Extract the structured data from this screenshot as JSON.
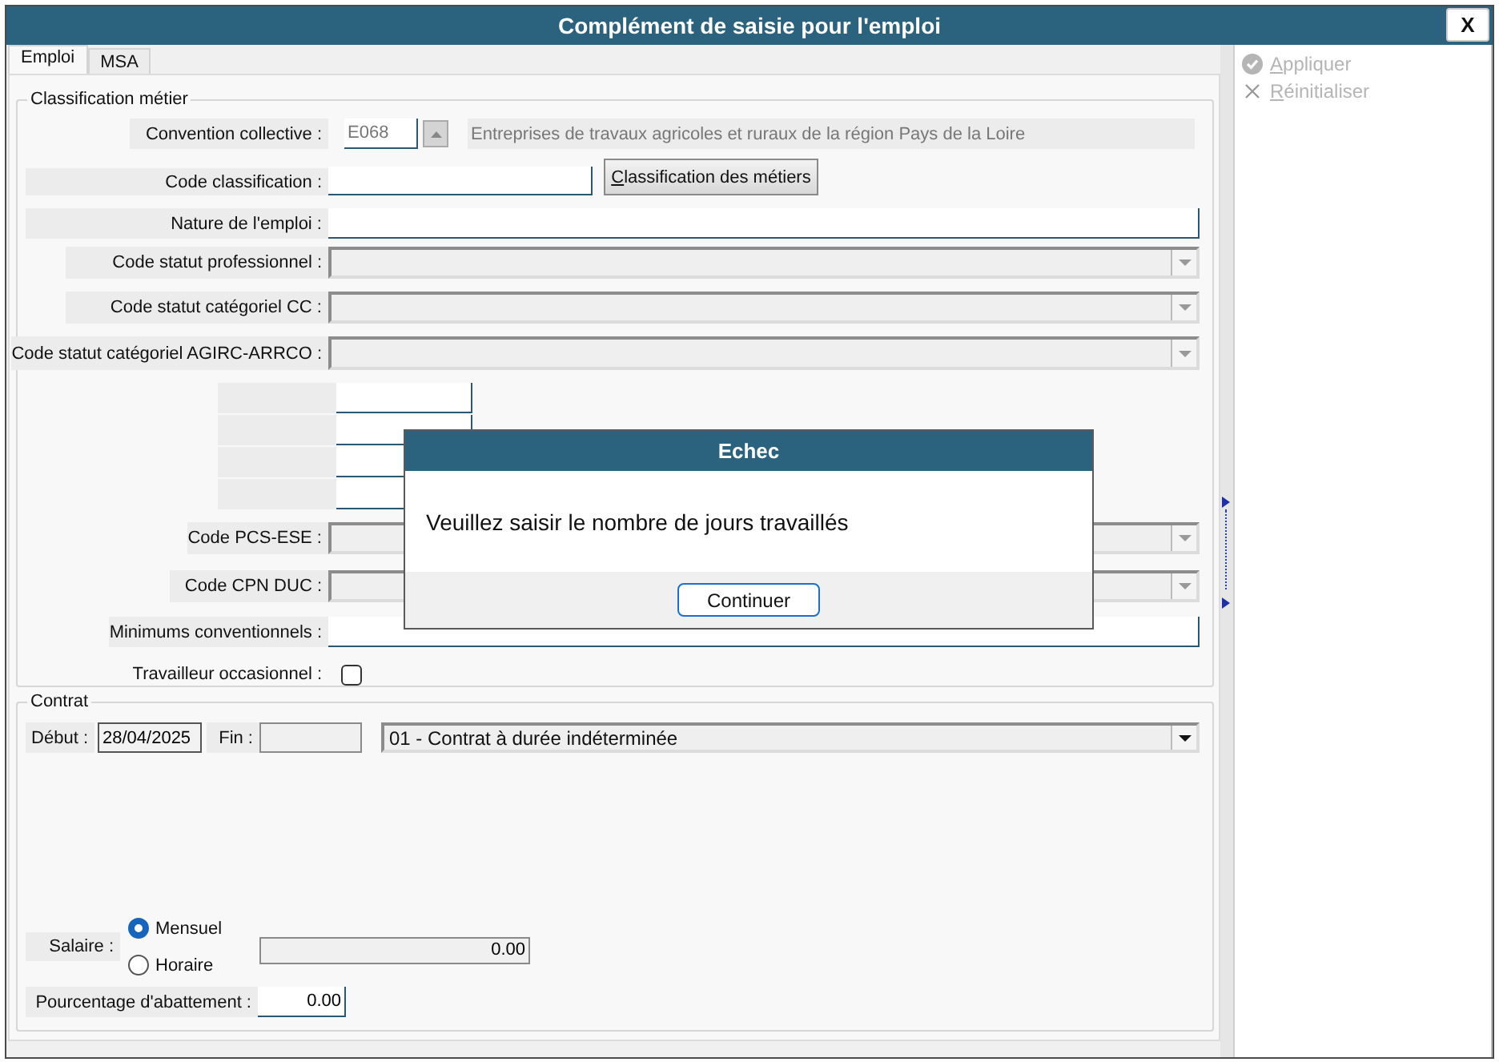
{
  "window": {
    "title": "Complément de saisie pour l'emploi",
    "close_label": "X"
  },
  "tabs": [
    {
      "label": "Emploi",
      "selected": true
    },
    {
      "label": "MSA",
      "selected": false
    }
  ],
  "classification": {
    "title": "Classification métier",
    "fields": [
      {
        "kind": "lookup",
        "label": "Convention collective :",
        "code": "E068",
        "description": "Entreprises de travaux agricoles et ruraux de la région Pays de la Loire",
        "disabled": true
      },
      {
        "kind": "input_button",
        "label": "Code classification :",
        "button": "Classification des métiers"
      },
      {
        "kind": "input",
        "label": "Nature de l'emploi :"
      },
      {
        "kind": "combo",
        "label": "Code statut professionnel :",
        "disabled": true
      },
      {
        "kind": "combo",
        "label": "Code statut catégoriel CC :",
        "disabled": true
      },
      {
        "kind": "combo",
        "label": "Code statut catégoriel AGIRC-ARRCO :",
        "disabled": true
      },
      {
        "kind": "blank_input"
      },
      {
        "kind": "blank_input"
      },
      {
        "kind": "blank_input"
      },
      {
        "kind": "blank_input"
      },
      {
        "kind": "combo",
        "label": "Code PCS-ESE :",
        "disabled": true
      },
      {
        "kind": "combo",
        "label": "Code CPN DUC :",
        "disabled": true
      },
      {
        "kind": "input",
        "label": "Minimums conventionnels :"
      },
      {
        "kind": "checkbox",
        "label": "Travailleur occasionnel :",
        "checked": false
      }
    ]
  },
  "contrat": {
    "title": "Contrat",
    "start": {
      "label": "Début :",
      "value": "28/04/2025"
    },
    "end": {
      "label": "Fin :",
      "disabled": true
    },
    "type": {
      "value": "01 - Contrat à durée indéterminée",
      "disabled": false
    },
    "salary": {
      "label": "Salaire :",
      "options": [
        {
          "label": "Mensuel",
          "selected": true
        },
        {
          "label": "Horaire",
          "selected": false
        }
      ],
      "amount": "0.00",
      "disabled": true
    },
    "reduction": {
      "label": "Pourcentage d'abattement :",
      "value": "0.00"
    }
  },
  "actions": [
    {
      "kind": "apply",
      "label": "Appliquer",
      "disabled": true
    },
    {
      "kind": "reset",
      "label": "Réinitialiser",
      "disabled": true
    }
  ],
  "dialog": {
    "title": "Echec",
    "message": "Veuillez saisir le nombre de jours travaillés",
    "button": "Continuer"
  }
}
